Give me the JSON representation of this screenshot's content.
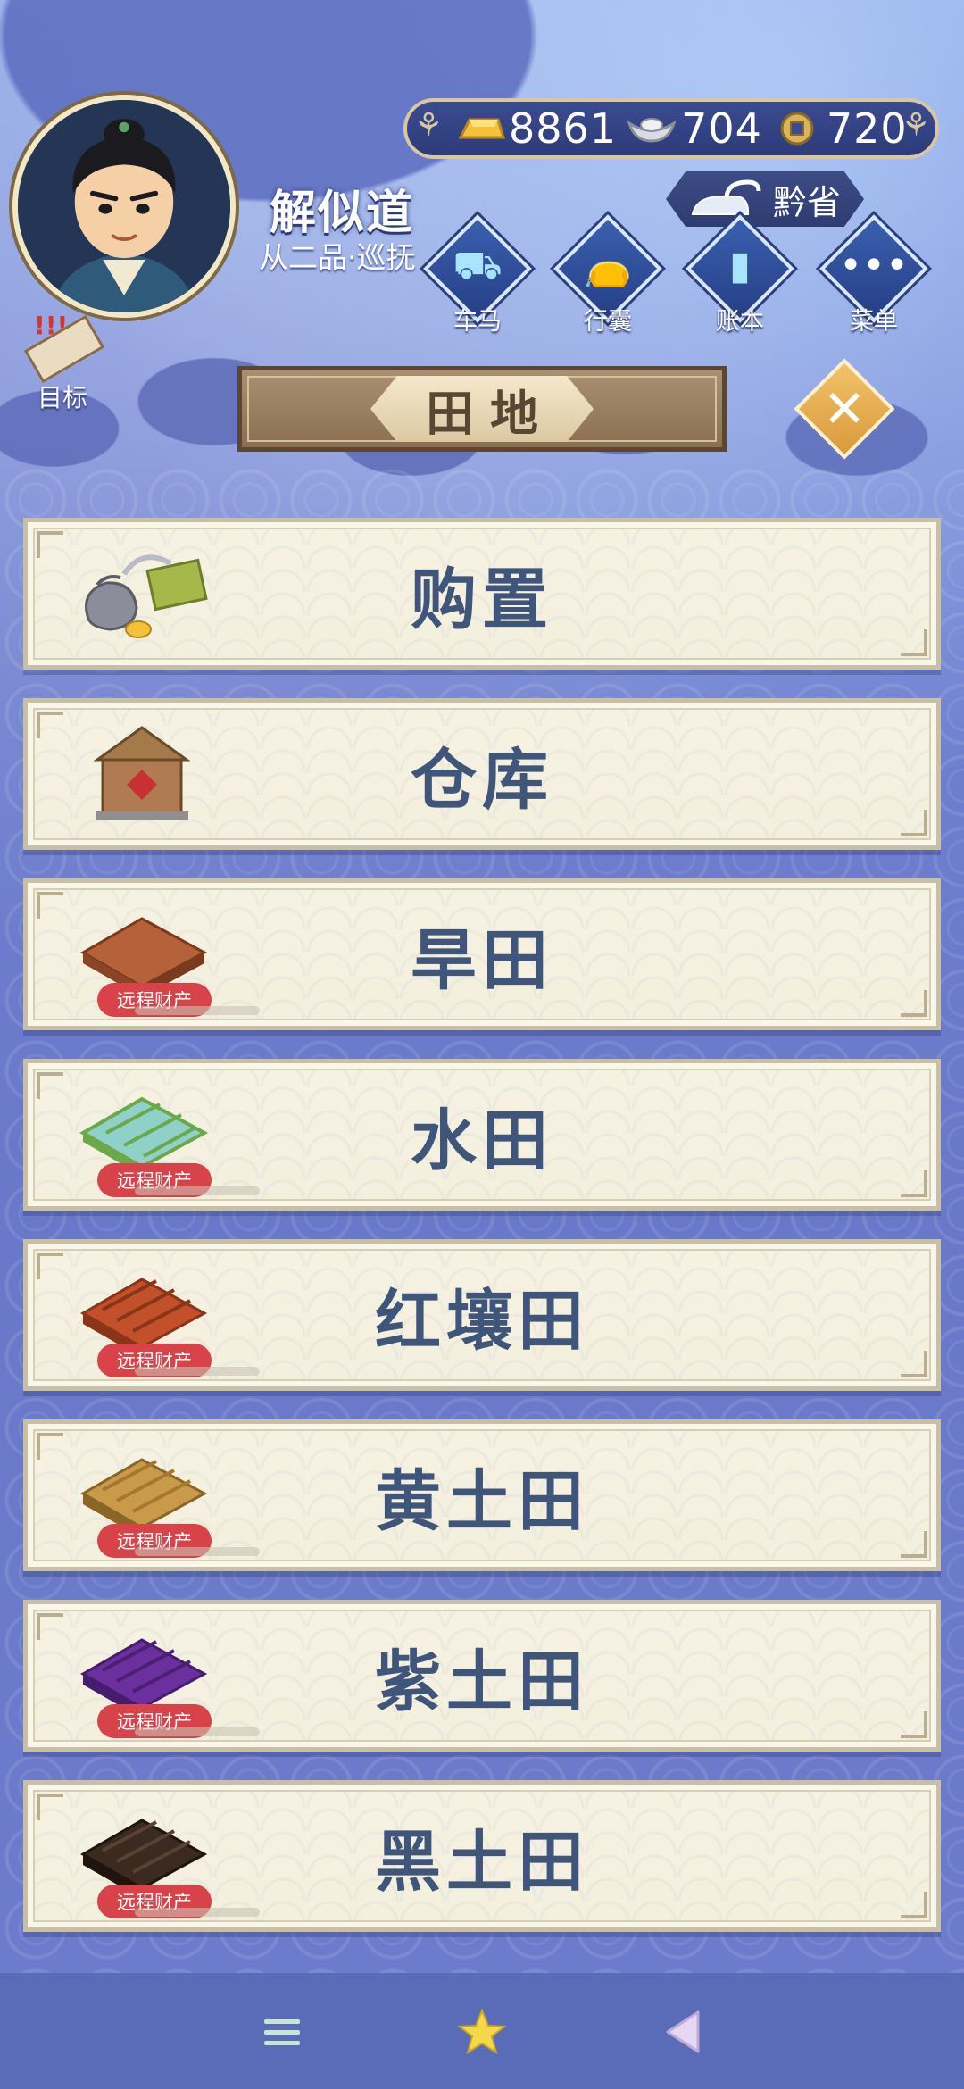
{
  "player": {
    "name": "解似道",
    "rank": "从二品·巡抚"
  },
  "currency": {
    "gold": "8861",
    "silver": "704",
    "copper": "720"
  },
  "province": {
    "label": "黔省"
  },
  "top_menu": [
    {
      "label": "车马",
      "icon": "carriage-icon"
    },
    {
      "label": "行囊",
      "icon": "bundle-icon"
    },
    {
      "label": "账本",
      "icon": "ledger-icon"
    },
    {
      "label": "菜单",
      "icon": "more-icon"
    }
  ],
  "goal": {
    "label": "目标"
  },
  "title": "田地",
  "items": [
    {
      "label": "购置",
      "icon": "purchase-icon",
      "badge": ""
    },
    {
      "label": "仓库",
      "icon": "warehouse-icon",
      "badge": ""
    },
    {
      "label": "旱田",
      "icon": "dry-field-icon",
      "badge": "远程财产",
      "color": "#b5623a"
    },
    {
      "label": "水田",
      "icon": "paddy-field-icon",
      "badge": "远程财产",
      "color": "#8fd0c8"
    },
    {
      "label": "红壤田",
      "icon": "red-soil-icon",
      "badge": "远程财产",
      "color": "#c2502a"
    },
    {
      "label": "黄土田",
      "icon": "yellow-soil-icon",
      "badge": "远程财产",
      "color": "#c99a4a"
    },
    {
      "label": "紫土田",
      "icon": "purple-soil-icon",
      "badge": "远程财产",
      "color": "#6b2f9e"
    },
    {
      "label": "黑土田",
      "icon": "black-soil-icon",
      "badge": "远程财产",
      "color": "#3a2a20"
    }
  ],
  "colors": {
    "label": "#40557a",
    "badge": "#d8434a",
    "banner": "#8a7050"
  }
}
